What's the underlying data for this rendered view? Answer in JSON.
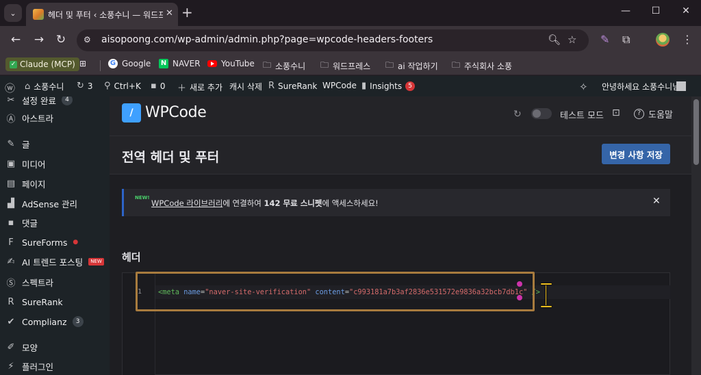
{
  "browser": {
    "tab_title": "헤더 및 푸터 ‹ 소풍수니 — 워드프레스",
    "url": "aisopoong.com/wp-admin/admin.php?page=wpcode-headers-footers",
    "bookmarks": [
      {
        "label": "Claude (MCP)",
        "icon": "check-icon"
      },
      {
        "label": "Google",
        "icon": "google-icon"
      },
      {
        "label": "NAVER",
        "icon": "naver-icon"
      },
      {
        "label": "YouTube",
        "icon": "youtube-icon"
      },
      {
        "label": "소풍수니",
        "icon": "folder-icon"
      },
      {
        "label": "워드프레스",
        "icon": "folder-icon"
      },
      {
        "label": "ai 작업하기",
        "icon": "folder-icon"
      },
      {
        "label": "주식회사 소풍",
        "icon": "folder-icon"
      }
    ]
  },
  "adminbar": {
    "site_name": "소풍수니",
    "updates_count": "3",
    "shortcut": "Ctrl+K",
    "comments_count": "0",
    "add_new": "새로 추가",
    "clear_cache": "캐시 삭제",
    "surerank": "SureRank",
    "wpcode": "WPCode",
    "insights": "Insights",
    "insights_count": "5",
    "greeting": "안녕하세요 소풍수니님"
  },
  "sidebar": {
    "items": [
      {
        "label": "설정 완료",
        "icon": "setup-icon",
        "count": "4"
      },
      {
        "label": "아스트라",
        "icon": "astra-icon"
      },
      {
        "label": "글",
        "icon": "pin-icon"
      },
      {
        "label": "미디어",
        "icon": "media-icon"
      },
      {
        "label": "페이지",
        "icon": "page-icon"
      },
      {
        "label": "AdSense 관리",
        "icon": "chart-icon"
      },
      {
        "label": "댓글",
        "icon": "comment-icon"
      },
      {
        "label": "SureForms",
        "icon": "sureforms-icon"
      },
      {
        "label": "AI 트렌드 포스팅",
        "icon": "pen-icon",
        "badge": "NEW"
      },
      {
        "label": "스펙트라",
        "icon": "spectra-icon"
      },
      {
        "label": "SureRank",
        "icon": "surerank-icon"
      },
      {
        "label": "Complianz",
        "icon": "check-icon",
        "count": "3"
      },
      {
        "label": "모양",
        "icon": "brush-icon"
      },
      {
        "label": "플러그인",
        "icon": "plug-icon"
      }
    ]
  },
  "wpcode": {
    "logo_text": "WPCode",
    "test_mode": "테스트 모드",
    "help": "도움말",
    "page_title": "전역 헤더 및 푸터",
    "save_label": "변경 사항 저장",
    "notice_new": "NEW!",
    "notice_link": "WPCode 라이브러리",
    "notice_mid": "에 연결하여 ",
    "notice_bold": "142 무료 스니펫",
    "notice_end": "에 액세스하세요!",
    "section_header": "헤더",
    "code_line_number": "1",
    "code": {
      "tag_open": "<meta",
      "attr1": "name",
      "val1": "\"naver-site-verification\"",
      "attr2": "content",
      "val2": "\"c993181a7b3af2836e531572e9836a32bcb7db1c\"",
      "tag_close": "/>"
    }
  },
  "colors": {
    "accent": "#3565a8",
    "highlight": "#a87b3e",
    "notice_border": "#2d64c8"
  }
}
